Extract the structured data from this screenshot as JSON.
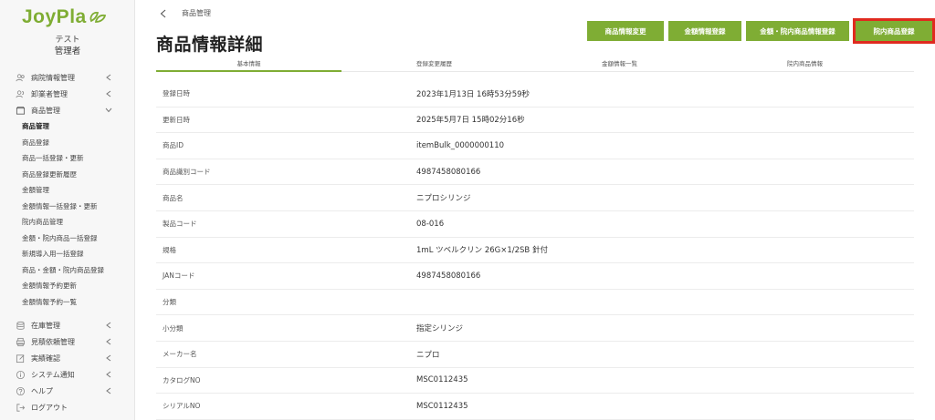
{
  "brand": {
    "logo_text": "JoyPla",
    "accent": "#7fad34"
  },
  "user": {
    "name": "テスト",
    "role": "管理者"
  },
  "sidebar": {
    "groups_top": [
      {
        "label": "病院情報管理",
        "icon": "users-icon"
      },
      {
        "label": "卸業者管理",
        "icon": "user-group-icon"
      },
      {
        "label": "商品管理",
        "icon": "box-icon"
      }
    ],
    "sub_items": [
      "商品管理",
      "商品登録",
      "商品一括登録・更新",
      "商品登録更新履歴",
      "金額管理",
      "金額情報一括登録・更新",
      "院内商品管理",
      "金額・院内商品一括登録",
      "新規導入用一括登録",
      "商品・金額・院内商品登録",
      "金額情報予約更新",
      "金額情報予約一覧"
    ],
    "groups_bottom": [
      {
        "label": "在庫管理",
        "icon": "database-icon"
      },
      {
        "label": "見積依頼管理",
        "icon": "printer-icon"
      },
      {
        "label": "実績確認",
        "icon": "edit-icon"
      },
      {
        "label": "システム通知",
        "icon": "info-icon"
      },
      {
        "label": "ヘルプ",
        "icon": "help-icon"
      },
      {
        "label": "ログアウト",
        "icon": "logout-icon"
      }
    ]
  },
  "breadcrumb": {
    "label": "商品管理"
  },
  "page": {
    "title": "商品情報詳細"
  },
  "actions": {
    "edit": "商品情報変更",
    "price_register": "金額情報登録",
    "price_inhouse_register": "金額・院内商品情報登録",
    "inhouse_register": "院内商品登録"
  },
  "tabs": [
    "基本情報",
    "登録変更履歴",
    "金額情報一覧",
    "院内商品情報"
  ],
  "details": [
    {
      "label": "登録日時",
      "value": "2023年1月13日 16時53分59秒"
    },
    {
      "label": "更新日時",
      "value": "2025年5月7日 15時02分16秒"
    },
    {
      "label": "商品ID",
      "value": "itemBulk_0000000110"
    },
    {
      "label": "商品識別コード",
      "value": "4987458080166"
    },
    {
      "label": "商品名",
      "value": "ニプロシリンジ"
    },
    {
      "label": "製品コード",
      "value": "08-016"
    },
    {
      "label": "規格",
      "value": "1mL ツベルクリン 26G×1/2SB 針付"
    },
    {
      "label": "JANコード",
      "value": "4987458080166"
    },
    {
      "label": "分類",
      "value": ""
    },
    {
      "label": "小分類",
      "value": "指定シリンジ"
    },
    {
      "label": "メーカー名",
      "value": "ニプロ"
    },
    {
      "label": "カタログNO",
      "value": "MSC0112435"
    },
    {
      "label": "シリアルNO",
      "value": "MSC0112435"
    }
  ]
}
